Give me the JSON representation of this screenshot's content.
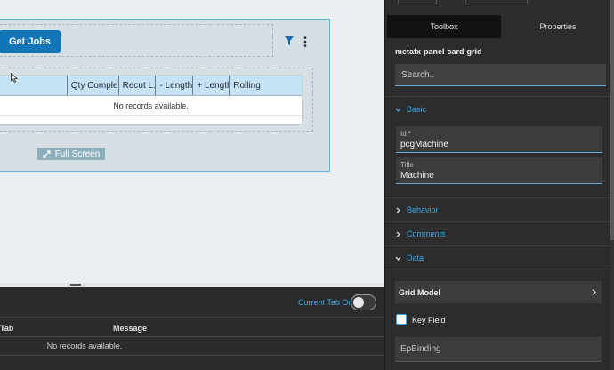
{
  "canvas": {
    "get_jobs_label": "Get Jobs",
    "grid_columns": [
      "Qty Complete",
      "Recut L...",
      "- Length",
      "+ Length",
      "Rolling"
    ],
    "grid_empty_text": "No records available.",
    "fullscreen_label": "Full Screen"
  },
  "bottom_panel": {
    "current_tab_only_label": "Current Tab Only",
    "current_tab_only_on": false,
    "columns": [
      "Tab",
      "Message"
    ],
    "empty_text": "No records available."
  },
  "sidebar": {
    "tabs": [
      {
        "label": "Toolbox",
        "active": true
      },
      {
        "label": "Properties",
        "active": false
      }
    ],
    "component_name": "metafx-panel-card-grid",
    "search_placeholder": "Search..",
    "sections": {
      "basic": "Basic",
      "behavior": "Behavior",
      "comments": "Comments",
      "data": "Data"
    },
    "fields": {
      "id_label": "Id *",
      "id_value": "pcgMachine",
      "title_label": "Title",
      "title_value": "Machine"
    },
    "grid_model_label": "Grid Model",
    "key_field_label": "Key Field",
    "key_field_checked": false,
    "epbinding_placeholder": "EpBinding"
  },
  "colors": {
    "primary_button": "#1175b8",
    "grid_header": "#c6e2f6",
    "accent": "#3aa8e8",
    "sidebar_bg": "#2c2c2c"
  }
}
